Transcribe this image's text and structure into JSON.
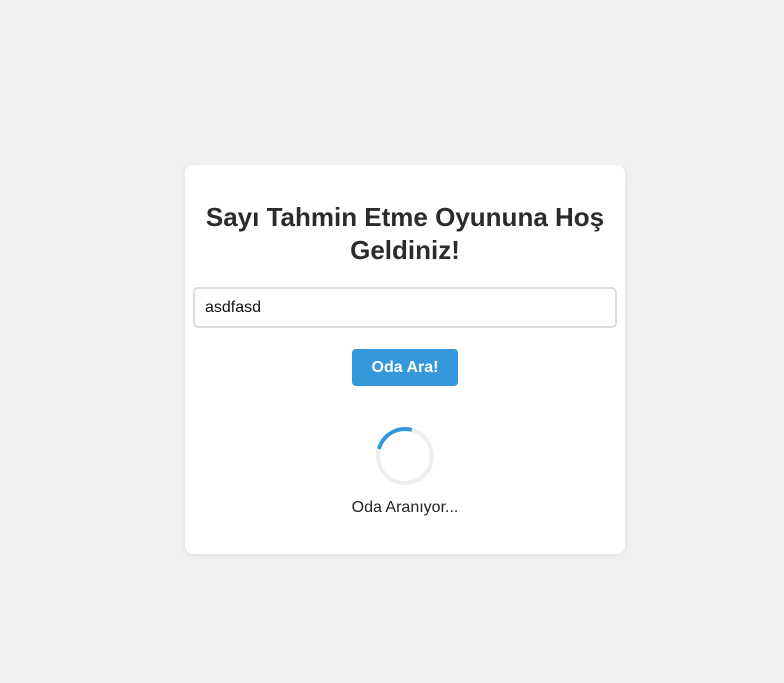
{
  "card": {
    "title": "Sayı Tahmin Etme Oyununa Hoş Geldiniz!",
    "input_value": "asdfasd",
    "search_button_label": "Oda Ara!",
    "status_text": "Oda Aranıyor..."
  },
  "colors": {
    "background": "#f1f1f1",
    "card": "#ffffff",
    "accent": "#3498db",
    "title": "#2b2b2b"
  },
  "icons": {
    "loading": "loading-spinner-icon"
  }
}
